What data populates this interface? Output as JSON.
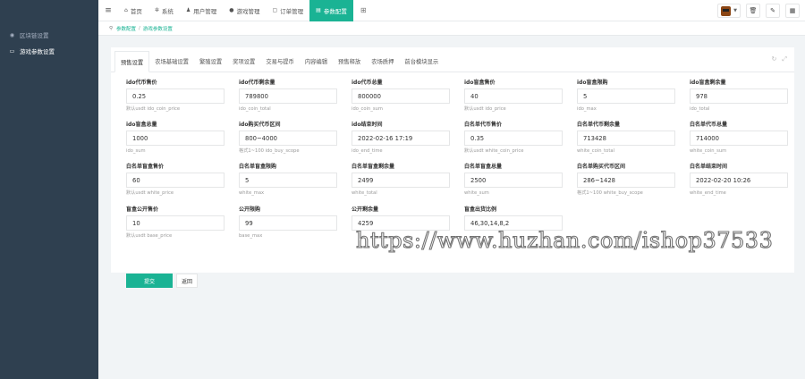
{
  "sidebar": {
    "items": [
      {
        "label": "区块链设置",
        "icon": "circle-icon",
        "active": false
      },
      {
        "label": "游戏参数设置",
        "icon": "inbox-icon",
        "active": true
      }
    ]
  },
  "topnav": {
    "toggle_icon": "hamburger-icon",
    "items": [
      {
        "label": "首页",
        "icon": "home-icon"
      },
      {
        "label": "系统",
        "icon": "gear-icon"
      },
      {
        "label": "用户管理",
        "icon": "user-icon"
      },
      {
        "label": "游戏管理",
        "icon": "gamepad-icon"
      },
      {
        "label": "订单管理",
        "icon": "order-icon"
      },
      {
        "label": "参数配置",
        "icon": "list-icon",
        "active": true
      }
    ],
    "grid_icon": "grid-icon",
    "right_icons": [
      "trash-icon",
      "edit-icon",
      "layout-icon"
    ]
  },
  "breadcrumb": {
    "items": [
      "参数配置",
      "游戏参数设置"
    ]
  },
  "tabs": [
    {
      "label": "预售设置",
      "active": true
    },
    {
      "label": "农场基础设置"
    },
    {
      "label": "繁殖设置"
    },
    {
      "label": "奖项设置"
    },
    {
      "label": "交易与提币"
    },
    {
      "label": "内容编辑"
    },
    {
      "label": "预售释放"
    },
    {
      "label": "农场质押"
    },
    {
      "label": "前台模块显示"
    }
  ],
  "fields": [
    {
      "label": "ido代币售价",
      "value": "0.25",
      "hint": "默认usdt ido_coin_price"
    },
    {
      "label": "ido代币剩余量",
      "value": "789800",
      "hint": "ido_coin_total"
    },
    {
      "label": "ido代币总量",
      "value": "800000",
      "hint": "ido_coin_sum"
    },
    {
      "label": "ido盲盒售价",
      "value": "40",
      "hint": "默认usdt ido_price"
    },
    {
      "label": "ido盲盒限购",
      "value": "5",
      "hint": "ido_max"
    },
    {
      "label": "ido盲盒剩余量",
      "value": "978",
      "hint": "ido_total"
    },
    {
      "label": "ido盲盒总量",
      "value": "1000",
      "hint": "ido_sum"
    },
    {
      "label": "ido购买代币区间",
      "value": "800~4000",
      "hint": "格式1~100 ido_buy_scope"
    },
    {
      "label": "ido结束时间",
      "value": "2022-02-16 17:19",
      "hint": "ido_end_time"
    },
    {
      "label": "白名单代币售价",
      "value": "0.35",
      "hint": "默认usdt white_coin_price"
    },
    {
      "label": "白名单代币剩余量",
      "value": "713428",
      "hint": "white_coin_total"
    },
    {
      "label": "白名单代币总量",
      "value": "714000",
      "hint": "white_coin_sum"
    },
    {
      "label": "白名单盲盒售价",
      "value": "60",
      "hint": "默认usdt white_price"
    },
    {
      "label": "白名单盲盒限购",
      "value": "5",
      "hint": "white_max"
    },
    {
      "label": "白名单盲盒剩余量",
      "value": "2499",
      "hint": "white_total"
    },
    {
      "label": "白名单盲盒总量",
      "value": "2500",
      "hint": "white_sum"
    },
    {
      "label": "白名单购买代币区间",
      "value": "286~1428",
      "hint": "格式1~100 white_buy_scope"
    },
    {
      "label": "白名单结束时间",
      "value": "2022-02-20 10:26",
      "hint": "white_end_time"
    },
    {
      "label": "盲盒公开售价",
      "value": "10",
      "hint": "默认usdt base_price"
    },
    {
      "label": "公开限购",
      "value": "99",
      "hint": "base_max"
    },
    {
      "label": "公开剩余量",
      "value": "4259",
      "hint": ""
    },
    {
      "label": "盲盒出货比例",
      "value": "46,30,14,8,2",
      "hint": ""
    }
  ],
  "actions": {
    "submit_label": "提交",
    "back_label": "返回"
  },
  "watermark": "https://www.huzhan.com/ishop37533",
  "colors": {
    "sidebar_bg": "#2f4050",
    "accent": "#1ab394"
  }
}
